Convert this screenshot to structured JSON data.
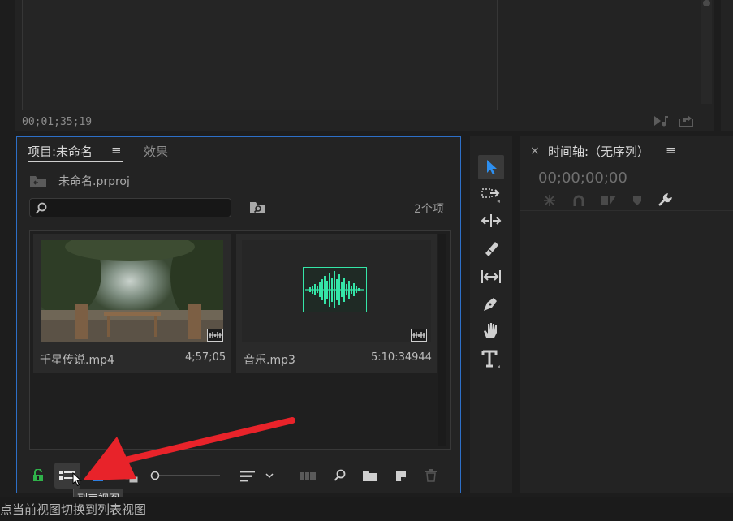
{
  "monitor": {
    "timecode": "00;01;35;19",
    "icons": [
      "audio-scrub-icon",
      "export-frame-icon"
    ]
  },
  "project_panel": {
    "tab_label": "项目:未命名",
    "menu_glyph": "≡",
    "effects_tab": "效果",
    "project_file": "未命名.prproj",
    "search": {
      "value": "",
      "placeholder": ""
    },
    "item_count": "2个项",
    "items": [
      {
        "name": "千星传说.mp4",
        "duration": "4;57;05",
        "type": "video"
      },
      {
        "name": "音乐.mp3",
        "duration": "5:10:34944",
        "type": "audio"
      }
    ],
    "toolbar": {
      "lock": "lock-icon",
      "list_view": "list-view-icon",
      "icon_view": "icon-view-icon",
      "freeform_view": "freeform-view-icon",
      "zoom": "zoom-slider",
      "sort": "sort-icon",
      "automate": "automate-to-sequence-icon",
      "find": "find-icon",
      "new_bin": "new-bin-icon",
      "new_item": "new-item-icon",
      "clear": "clear-icon"
    },
    "tooltip": "列表视图"
  },
  "tools": [
    "selection-tool",
    "track-select-tool",
    "ripple-edit-tool",
    "razor-tool",
    "slip-tool",
    "pen-tool",
    "hand-tool",
    "type-tool"
  ],
  "timeline": {
    "close_glyph": "×",
    "title": "时间轴:（无序列）",
    "menu_glyph": "≡",
    "timecode": "00;00;00;00"
  },
  "status_bar": {
    "text": "点当前视图切换到列表视图"
  },
  "colors": {
    "accent_blue": "#2d6fc7",
    "audio_wave": "#35e6a8",
    "arrow_red": "#e8232a"
  }
}
